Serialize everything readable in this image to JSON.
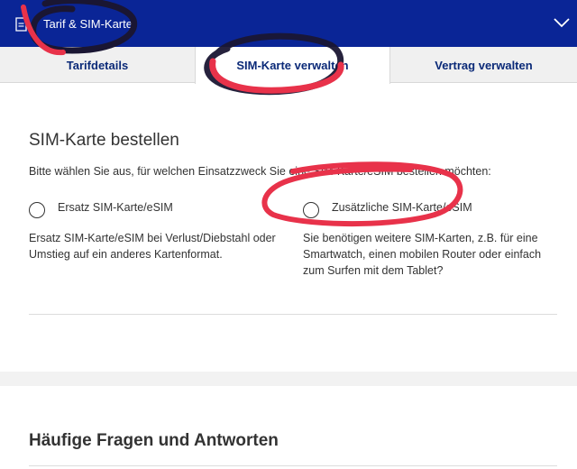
{
  "header": {
    "title": "Tarif & SIM-Karte",
    "colors": {
      "bar": "#0a2596",
      "text": "#ffffff"
    },
    "icons": {
      "left": "document-icon",
      "right": "chevron-down-icon"
    }
  },
  "tabs": [
    {
      "label": "Tarifdetails",
      "active": false
    },
    {
      "label": "SIM-Karte verwalten",
      "active": true
    },
    {
      "label": "Vertrag verwalten",
      "active": false
    }
  ],
  "order": {
    "title": "SIM-Karte bestellen",
    "intro": "Bitte wählen Sie aus, für welchen Einsatzzweck Sie eine SIM-Karte/eSIM bestellen möchten:",
    "options": [
      {
        "label": "Ersatz SIM-Karte/eSIM",
        "description": "Ersatz SIM-Karte/eSIM bei Verlust/Diebstahl oder Umstieg auf ein anderes Kartenformat.",
        "selected": false
      },
      {
        "label": "Zusätzliche SIM-Karte/eSIM",
        "description": "Sie benötigen weitere SIM-Karten, z.B. für eine Smartwatch, einen mobilen Router oder einfach zum Surfen mit dem Tablet?",
        "selected": false
      }
    ]
  },
  "faq": {
    "title": "Häufige Fragen und Antworten"
  },
  "annotations": {
    "marker_color": "#e8324a"
  }
}
